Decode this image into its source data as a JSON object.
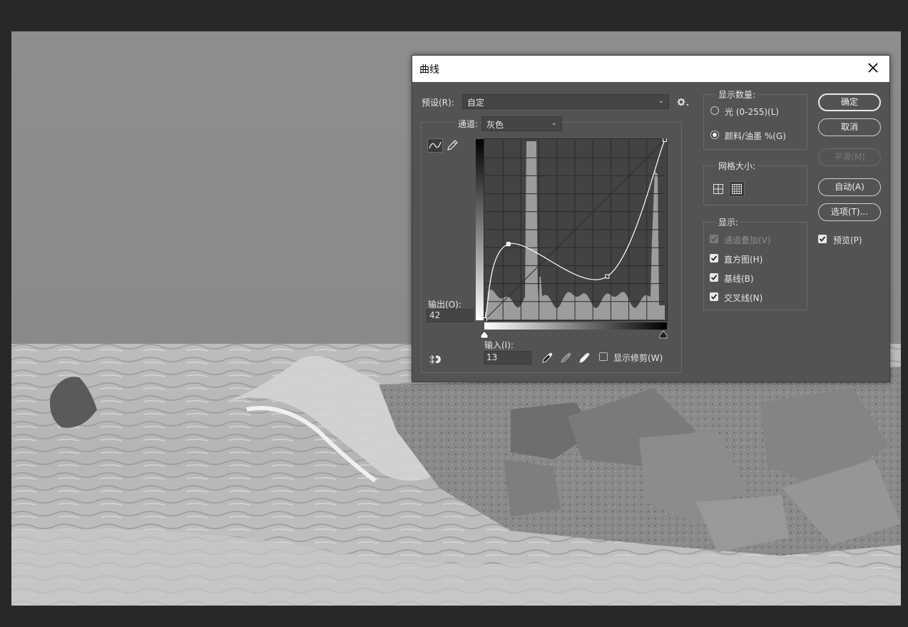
{
  "dialog": {
    "title": "曲线",
    "preset_label": "预设(R):",
    "preset_value": "自定",
    "channel_label": "通道:",
    "channel_value": "灰色",
    "output_label": "输出(O):",
    "output_value": "42",
    "input_label": "输入(I):",
    "input_value": "13",
    "show_clipping_label": "显示修剪(W)",
    "show_clipping_checked": false,
    "buttons": {
      "ok": "确定",
      "cancel": "取消",
      "smooth": "平滑(M)",
      "auto": "自动(A)",
      "options": "选项(T)..."
    },
    "preview_label": "预览(P)",
    "preview_checked": true,
    "show_amount": {
      "title": "显示数量:",
      "light": "光 (0-255)(L)",
      "pigment": "颜料/油墨 %(G)",
      "selected": "pigment"
    },
    "grid_size": {
      "title": "网格大小:",
      "selected": "fine"
    },
    "display": {
      "title": "显示:",
      "channel_overlay": "通道叠加(V)",
      "histogram": "直方图(H)",
      "baseline": "基线(B)",
      "intersection": "交叉线(N)"
    }
  },
  "curve": {
    "points": [
      [
        0,
        0
      ],
      [
        13,
        42
      ],
      [
        68,
        24
      ],
      [
        100,
        100
      ]
    ],
    "selected_point": 1
  },
  "colors": {
    "dialog_bg": "#535353",
    "curve": "#ffffff",
    "histogram": "#9c9c9c"
  },
  "icons": [
    "close-icon",
    "curve-tool-icon",
    "pencil-tool-icon",
    "gear-icon",
    "target-adjust-icon",
    "eyedropper-black-icon",
    "eyedropper-gray-icon",
    "eyedropper-white-icon",
    "grid-coarse-icon",
    "grid-fine-icon"
  ]
}
